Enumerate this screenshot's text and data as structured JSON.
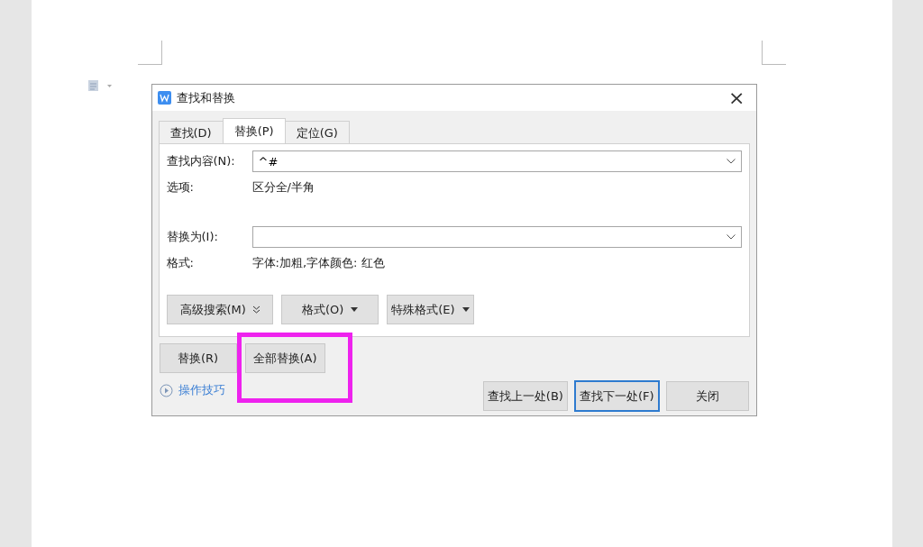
{
  "dialog": {
    "title": "查找和替换",
    "close": "×",
    "tabs": [
      {
        "label": "查找(D)",
        "selected": false
      },
      {
        "label": "替换(P)",
        "selected": true
      },
      {
        "label": "定位(G)",
        "selected": false
      }
    ],
    "find": {
      "label": "查找内容(N):",
      "value": "^#"
    },
    "find_options": {
      "label": "选项:",
      "value": "区分全/半角"
    },
    "replace": {
      "label": "替换为(I):"
    },
    "replace_format": {
      "label": "格式:",
      "value": "字体:加粗,字体颜色: 红色"
    },
    "option_buttons": [
      {
        "label": "高级搜索(M)",
        "kind": "expander"
      },
      {
        "label": "格式(O)",
        "kind": "dropdown"
      },
      {
        "label": "特殊格式(E)",
        "kind": "dropdown"
      }
    ],
    "replace_buttons": [
      {
        "label": "替换(R)",
        "highlighted": false
      },
      {
        "label": "全部替换(A)",
        "highlighted": true
      }
    ],
    "tips_link": "操作技巧",
    "nav_buttons": [
      {
        "label": "查找上一处(B)",
        "focused": false
      },
      {
        "label": "查找下一处(F)",
        "focused": true
      },
      {
        "label": "关闭",
        "focused": false
      }
    ]
  }
}
